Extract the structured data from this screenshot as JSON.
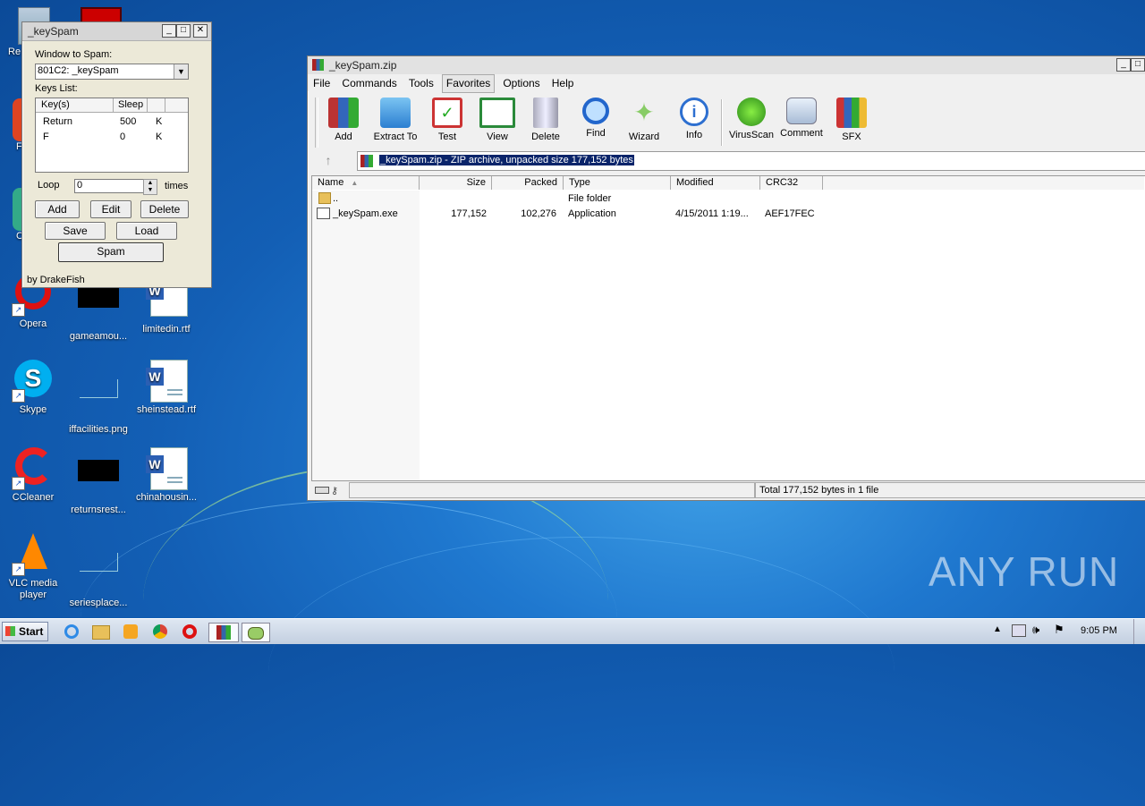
{
  "desktop": {
    "icons": [
      {
        "name": "icon-opera",
        "label": "Opera"
      },
      {
        "name": "icon-gameamou",
        "label": "gameamou..."
      },
      {
        "name": "icon-limitedin",
        "label": "limitedin.rtf"
      },
      {
        "name": "icon-skype",
        "label": "Skype"
      },
      {
        "name": "icon-iffacilities",
        "label": "iffacilities.png"
      },
      {
        "name": "icon-sheinstead",
        "label": "sheinstead.rtf"
      },
      {
        "name": "icon-ccleaner",
        "label": "CCleaner"
      },
      {
        "name": "icon-returnsrest",
        "label": "returnsrest..."
      },
      {
        "name": "icon-chinahousin",
        "label": "chinahousin..."
      },
      {
        "name": "icon-vlc",
        "label": "VLC media player"
      },
      {
        "name": "icon-seriesplace",
        "label": "seriesplace..."
      }
    ],
    "partial_labels": {
      "recycle": "Re",
      "left1": "F",
      "left2": "C"
    }
  },
  "keyspam": {
    "title": "_keySpam",
    "window_label": "Window to Spam:",
    "window_value": "801C2: _keySpam",
    "keys_label": "Keys List:",
    "columns": [
      "Key(s)",
      "Sleep"
    ],
    "rows": [
      {
        "key": "Return",
        "sleep": "500",
        "flag": "K"
      },
      {
        "key": "F",
        "sleep": "0",
        "flag": "K"
      }
    ],
    "loop_label": "Loop",
    "loop_value": "0",
    "times_label": "times",
    "buttons": {
      "add": "Add",
      "edit": "Edit",
      "delete": "Delete",
      "save": "Save",
      "load": "Load",
      "spam": "Spam"
    },
    "footer": "by DrakeFish"
  },
  "winrar": {
    "title": "_keySpam.zip",
    "menu": [
      "File",
      "Commands",
      "Tools",
      "Favorites",
      "Options",
      "Help"
    ],
    "toolbar": [
      "Add",
      "Extract To",
      "Test",
      "View",
      "Delete",
      "Find",
      "Wizard",
      "Info",
      "VirusScan",
      "Comment",
      "SFX"
    ],
    "address": "_keySpam.zip - ZIP archive, unpacked size 177,152 bytes",
    "columns": [
      "Name",
      "Size",
      "Packed",
      "Type",
      "Modified",
      "CRC32"
    ],
    "files": [
      {
        "name": "..",
        "size": "",
        "packed": "",
        "type": "File folder",
        "modified": "",
        "crc": ""
      },
      {
        "name": "_keySpam.exe",
        "size": "177,152",
        "packed": "102,276",
        "type": "Application",
        "modified": "4/15/2011 1:19...",
        "crc": "AEF17FEC"
      }
    ],
    "status": "Total 177,152 bytes in 1 file"
  },
  "taskbar": {
    "start": "Start",
    "clock": "9:05 PM"
  },
  "watermark": "ANY RUN",
  "colors": {
    "accent": "#1f78cf",
    "selection": "#0a246a",
    "taskbar": "#c3cfe0"
  }
}
